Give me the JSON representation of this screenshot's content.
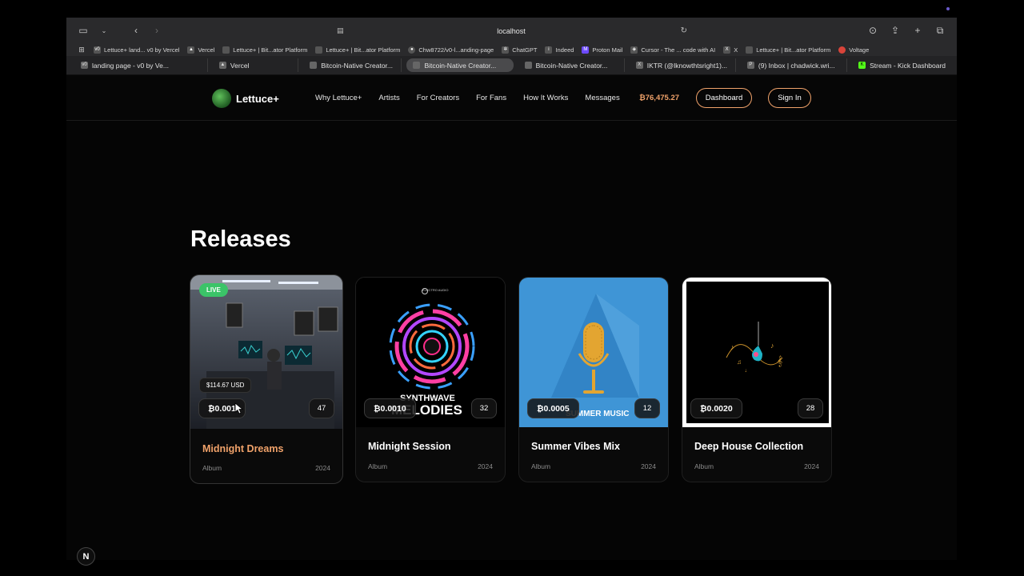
{
  "browser": {
    "url": "localhost",
    "bookmarks": [
      {
        "label": "Lettuce+ land... v0 by Vercel",
        "icon": "v0-icon"
      },
      {
        "label": "Vercel",
        "icon": "vercel-icon"
      },
      {
        "label": "Lettuce+ | Bit...ator Platform",
        "icon": "page-icon"
      },
      {
        "label": "Lettuce+ | Bit...ator Platform",
        "icon": "page-icon"
      },
      {
        "label": "Chw8722/v0-l...anding-page",
        "icon": "github-icon"
      },
      {
        "label": "ChatGPT",
        "icon": "chatgpt-icon"
      },
      {
        "label": "Indeed",
        "icon": "indeed-icon"
      },
      {
        "label": "Proton Mail",
        "icon": "proton-icon"
      },
      {
        "label": "Cursor - The ... code with AI",
        "icon": "cursor-icon"
      },
      {
        "label": "X",
        "icon": "x-icon"
      },
      {
        "label": "Lettuce+ | Bit...ator Platform",
        "icon": "page-icon"
      },
      {
        "label": "Voltage",
        "icon": "voltage-icon"
      }
    ],
    "tabs": [
      {
        "label": "landing page - v0 by Ve...",
        "active": false
      },
      {
        "label": "Vercel",
        "active": false
      },
      {
        "label": "Bitcoin-Native Creator...",
        "active": false
      },
      {
        "label": "Bitcoin-Native Creator...",
        "active": true
      },
      {
        "label": "Bitcoin-Native Creator...",
        "active": false
      },
      {
        "label": "IKTR (@Iknowthtsright1)...",
        "active": false
      },
      {
        "label": "(9) Inbox | chadwick.wri...",
        "active": false
      },
      {
        "label": "Stream - Kick Dashboard",
        "active": false
      }
    ]
  },
  "site": {
    "brand": "Lettuce+",
    "nav": [
      "Why Lettuce+",
      "Artists",
      "For Creators",
      "For Fans",
      "How It Works",
      "Messages"
    ],
    "balance": "₿76,475.27",
    "dashboard_label": "Dashboard",
    "signin_label": "Sign In"
  },
  "releases": {
    "heading": "Releases",
    "cards": [
      {
        "title": "Midnight Dreams",
        "type": "Album",
        "year": "2024",
        "price": "₿0.001",
        "count": "47",
        "live": "LIVE",
        "usd": "$114.67 USD",
        "hovered": true
      },
      {
        "title": "Midnight Session",
        "type": "Album",
        "year": "2024",
        "price": "₿0.0010",
        "count": "32",
        "art_text_1": "SYNTHWAVE",
        "art_text_2": "MELODIES",
        "art_brand": "ELECTRO AUDIO"
      },
      {
        "title": "Summer Vibes Mix",
        "type": "Album",
        "year": "2024",
        "price": "₿0.0005",
        "count": "12",
        "art_text_1": "SUMMER MUSIC"
      },
      {
        "title": "Deep House Collection",
        "type": "Album",
        "year": "2024",
        "price": "₿0.0020",
        "count": "28"
      }
    ]
  },
  "devtools_badge": "N",
  "colors": {
    "accent": "#f0a26a",
    "live": "#3bc468",
    "background": "#000000"
  }
}
